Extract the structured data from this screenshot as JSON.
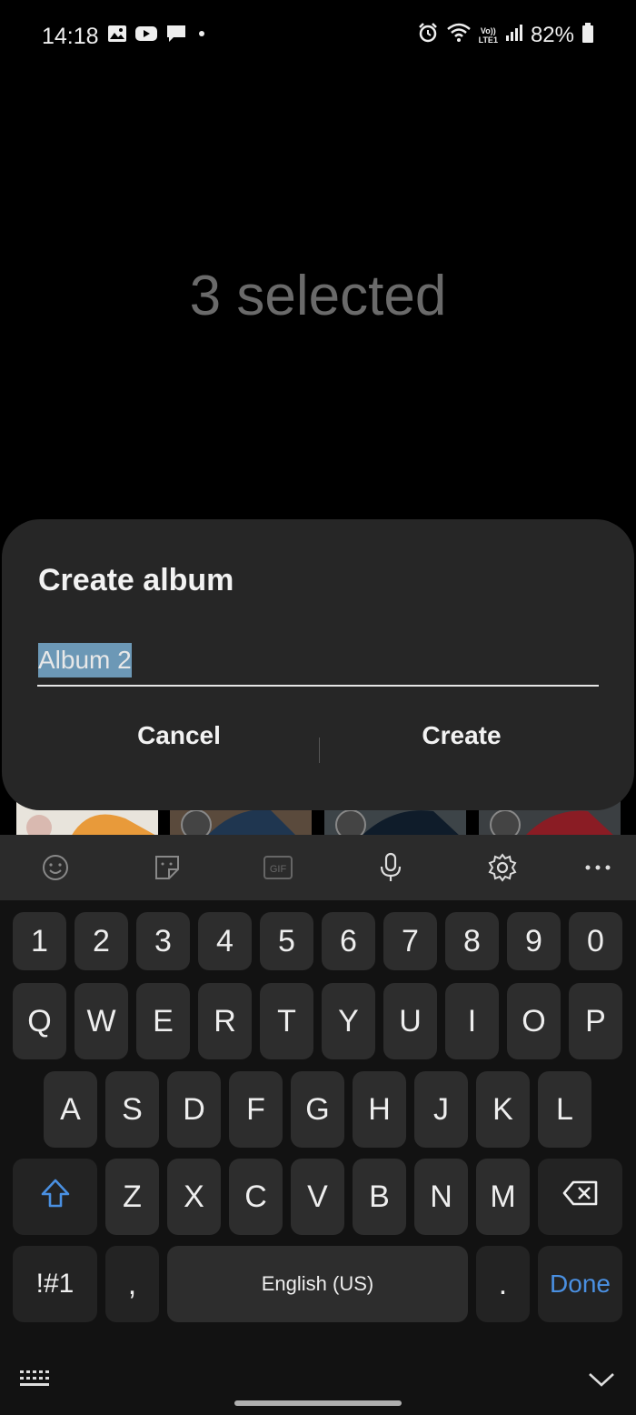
{
  "status": {
    "time": "14:18",
    "lte_top": "Vo))",
    "lte_bottom": "LTE1",
    "battery": "82%"
  },
  "header": {
    "selected": "3 selected"
  },
  "dialog": {
    "title": "Create album",
    "album_name": "Album 2",
    "cancel": "Cancel",
    "create": "Create"
  },
  "keyboard": {
    "toolbar": [
      "emoji-icon",
      "sticker-icon",
      "gif-icon",
      "microphone-icon",
      "settings-icon",
      "more-icon"
    ],
    "gif_label": "GIF",
    "numbers": [
      "1",
      "2",
      "3",
      "4",
      "5",
      "6",
      "7",
      "8",
      "9",
      "0"
    ],
    "row1": [
      "Q",
      "W",
      "E",
      "R",
      "T",
      "Y",
      "U",
      "I",
      "O",
      "P"
    ],
    "row2": [
      "A",
      "S",
      "D",
      "F",
      "G",
      "H",
      "J",
      "K",
      "L"
    ],
    "row3": [
      "Z",
      "X",
      "C",
      "V",
      "B",
      "N",
      "M"
    ],
    "symbols": "!#1",
    "comma": ",",
    "space": "English (US)",
    "period": ".",
    "done": "Done"
  }
}
